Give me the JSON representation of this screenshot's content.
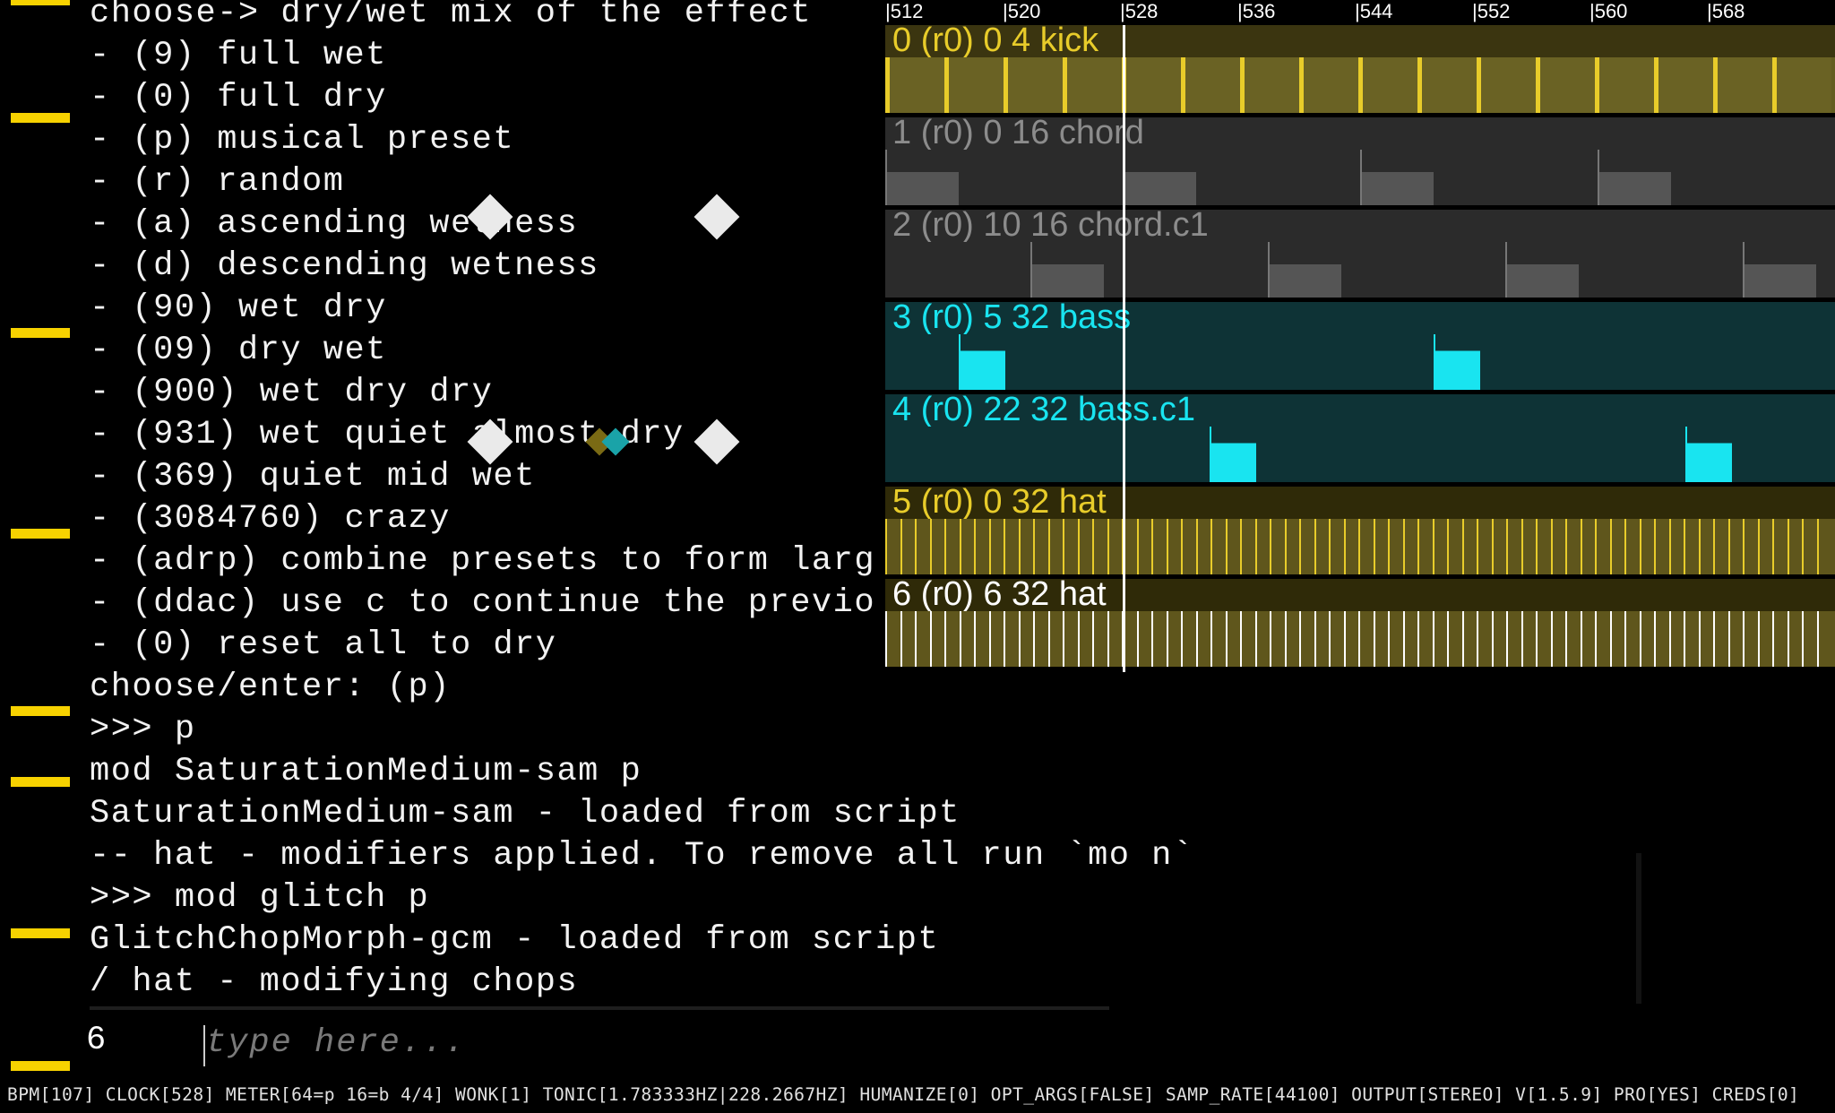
{
  "console": {
    "lines": [
      "choose-> dry/wet mix of the effect",
      "- (9) full wet",
      "- (0) full dry",
      "- (p) musical preset",
      "- (r) random",
      "- (a) ascending wetness",
      "- (d) descending wetness",
      "- (90) wet dry",
      "- (09) dry wet",
      "- (900) wet dry dry",
      "- (931) wet quiet almost dry",
      "- (369) quiet mid wet",
      "- (3084760) crazy",
      "- (adrp) combine presets to form larg",
      "- (ddac) use c to continue the previo",
      "- (0) reset all to dry",
      "choose/enter: (p)",
      ">>> p",
      "mod SaturationMedium-sam p",
      "SaturationMedium-sam - loaded from script",
      "-- hat - modifiers applied. To remove all run `mo n`",
      ">>> mod glitch p",
      "GlitchChopMorph-gcm - loaded from script",
      "/ hat - modifying chops"
    ]
  },
  "timeline": {
    "ruler_ticks": [
      "|512",
      "|520",
      "|528",
      "|536",
      "|544",
      "|552",
      "|560",
      "|568"
    ],
    "tracks": [
      {
        "label": "0 (r0) 0 4 kick",
        "color": "#e8cc2a",
        "bg": "#3b3510",
        "body_bg": "#645d20"
      },
      {
        "label": "1 (r0) 0 16 chord",
        "color": "#8c8c8c",
        "bg": "#2b2b2b",
        "body_bg": "#2b2b2b"
      },
      {
        "label": "2 (r0) 10 16 chord.c1",
        "color": "#8c8c8c",
        "bg": "#2b2b2b",
        "body_bg": "#2b2b2b"
      },
      {
        "label": "3 (r0) 5 32 bass",
        "color": "#19e4f0",
        "bg": "#0e3336",
        "body_bg": "#0e3336"
      },
      {
        "label": "4 (r0) 22 32 bass.c1",
        "color": "#19e4f0",
        "bg": "#0e3336",
        "body_bg": "#0e3336"
      },
      {
        "label": "5 (r0) 0 32 hat",
        "color": "#e8cc2a",
        "bg": "#2f2a08",
        "body_bg": "#5f561c"
      },
      {
        "label": "6 (r0) 6 32 hat",
        "color": "#ffffff",
        "bg": "#2f2a08",
        "body_bg": "#5f561c"
      }
    ]
  },
  "prompt": {
    "number": "6",
    "placeholder": "type here..."
  },
  "status_bar": "BPM[107] CLOCK[528] METER[64=p 16=b 4/4] WONK[1] TONIC[1.783333HZ|228.2667HZ] HUMANIZE[0] OPT_ARGS[FALSE] SAMP_RATE[44100] OUTPUT[STEREO] V[1.5.9] PRO[YES] CREDS[0]"
}
